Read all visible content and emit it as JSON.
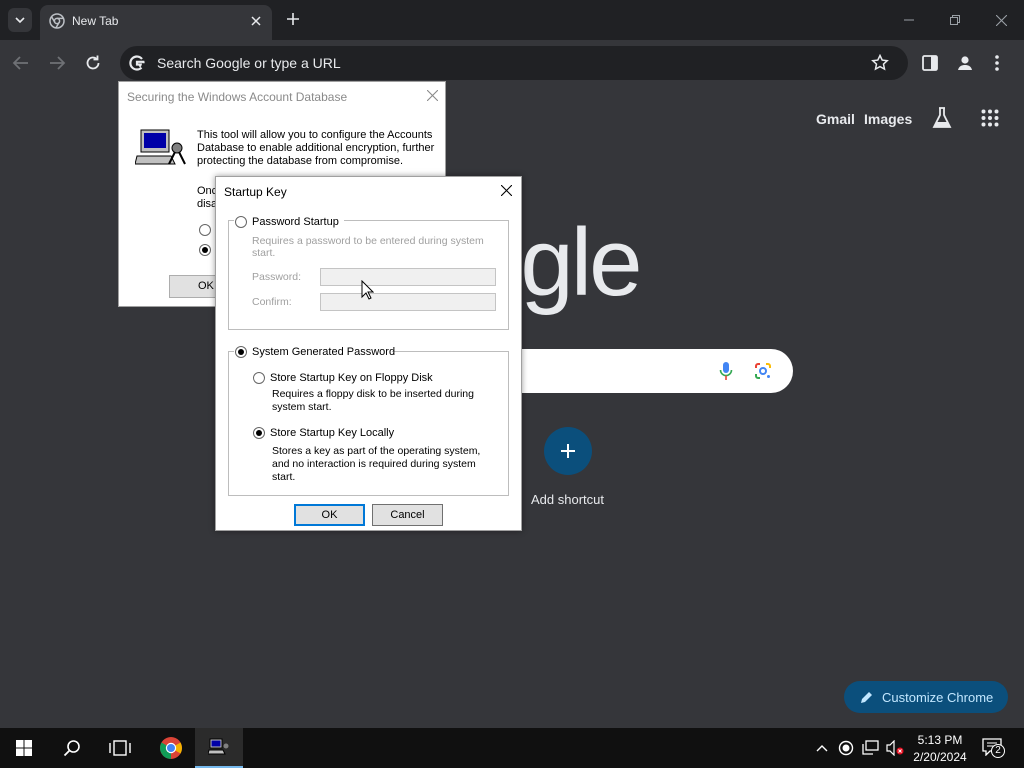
{
  "browser": {
    "tab_title": "New Tab",
    "omnibox_placeholder": "Search Google or type a URL",
    "ntp": {
      "gmail": "Gmail",
      "images": "Images",
      "logo": "ogle",
      "add_shortcut": "Add shortcut",
      "customize": "Customize Chrome"
    }
  },
  "back_dialog": {
    "title": "Securing the Windows Account Database",
    "text": "This tool will allow you to configure the Accounts Database to enable additional encryption, further protecting the database from compromise.",
    "line_once": "Onc",
    "line_disa": "disa",
    "ok": "OK"
  },
  "startup_key_dialog": {
    "title": "Startup Key",
    "password_startup": {
      "label": "Password Startup",
      "selected": false,
      "description": "Requires a password to be entered during system start.",
      "password_label": "Password:",
      "confirm_label": "Confirm:",
      "password_value": "",
      "confirm_value": ""
    },
    "system_generated": {
      "label": "System Generated Password",
      "selected": true,
      "floppy": {
        "label": "Store Startup Key on Floppy Disk",
        "selected": false,
        "description": "Requires a floppy disk to be inserted during system start."
      },
      "local": {
        "label": "Store Startup Key Locally",
        "selected": true,
        "description": "Stores a key as part of the operating system, and no interaction is required during system start."
      }
    },
    "ok": "OK",
    "cancel": "Cancel"
  },
  "taskbar": {
    "time": "5:13 PM",
    "date": "2/20/2024",
    "notification_count": "2"
  },
  "colors": {
    "page_bg": "#35363a",
    "tabstrip_bg": "#202124",
    "accent": "#0b4f7c",
    "dialog_focus": "#0078d7"
  }
}
